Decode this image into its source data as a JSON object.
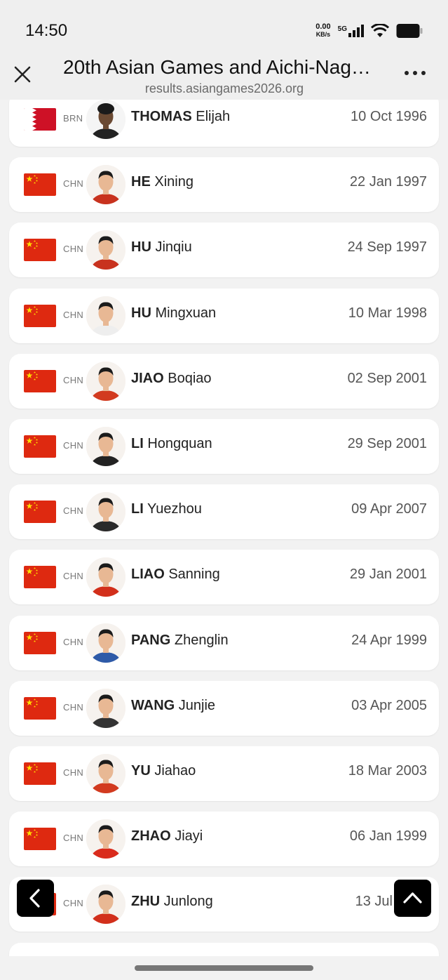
{
  "status_bar": {
    "time": "14:50",
    "net_speed_value": "0.00",
    "net_speed_unit": "KB/s",
    "network": "5G"
  },
  "header": {
    "title": "20th Asian Games and Aichi-Nag…",
    "url": "results.asiangames2026.org"
  },
  "colors": {
    "china_red": "#de2910",
    "china_yellow": "#ffde00",
    "bahrain_red": "#ce1126"
  },
  "athletes": [
    {
      "noc": "BRN",
      "flag": "bahrain-flag",
      "surname": "THOMAS",
      "given": "Elijah",
      "dob": "10 Oct 1996"
    },
    {
      "noc": "CHN",
      "flag": "china-flag",
      "surname": "HE",
      "given": "Xining",
      "dob": "22 Jan 1997"
    },
    {
      "noc": "CHN",
      "flag": "china-flag",
      "surname": "HU",
      "given": "Jinqiu",
      "dob": "24 Sep 1997"
    },
    {
      "noc": "CHN",
      "flag": "china-flag",
      "surname": "HU",
      "given": "Mingxuan",
      "dob": "10 Mar 1998"
    },
    {
      "noc": "CHN",
      "flag": "china-flag",
      "surname": "JIAO",
      "given": "Boqiao",
      "dob": "02 Sep 2001"
    },
    {
      "noc": "CHN",
      "flag": "china-flag",
      "surname": "LI",
      "given": "Hongquan",
      "dob": "29 Sep 2001"
    },
    {
      "noc": "CHN",
      "flag": "china-flag",
      "surname": "LI",
      "given": "Yuezhou",
      "dob": "09 Apr 2007"
    },
    {
      "noc": "CHN",
      "flag": "china-flag",
      "surname": "LIAO",
      "given": "Sanning",
      "dob": "29 Jan 2001"
    },
    {
      "noc": "CHN",
      "flag": "china-flag",
      "surname": "PANG",
      "given": "Zhenglin",
      "dob": "24 Apr 1999"
    },
    {
      "noc": "CHN",
      "flag": "china-flag",
      "surname": "WANG",
      "given": "Junjie",
      "dob": "03 Apr 2005"
    },
    {
      "noc": "CHN",
      "flag": "china-flag",
      "surname": "YU",
      "given": "Jiahao",
      "dob": "18 Mar 2003"
    },
    {
      "noc": "CHN",
      "flag": "china-flag",
      "surname": "ZHAO",
      "given": "Jiayi",
      "dob": "06 Jan 1999"
    },
    {
      "noc": "CHN",
      "flag": "china-flag",
      "surname": "ZHU",
      "given": "Junlong",
      "dob": "13 Jul"
    }
  ],
  "floating_buttons": {
    "back_icon": "chevron-left-icon",
    "top_icon": "chevron-up-icon"
  }
}
